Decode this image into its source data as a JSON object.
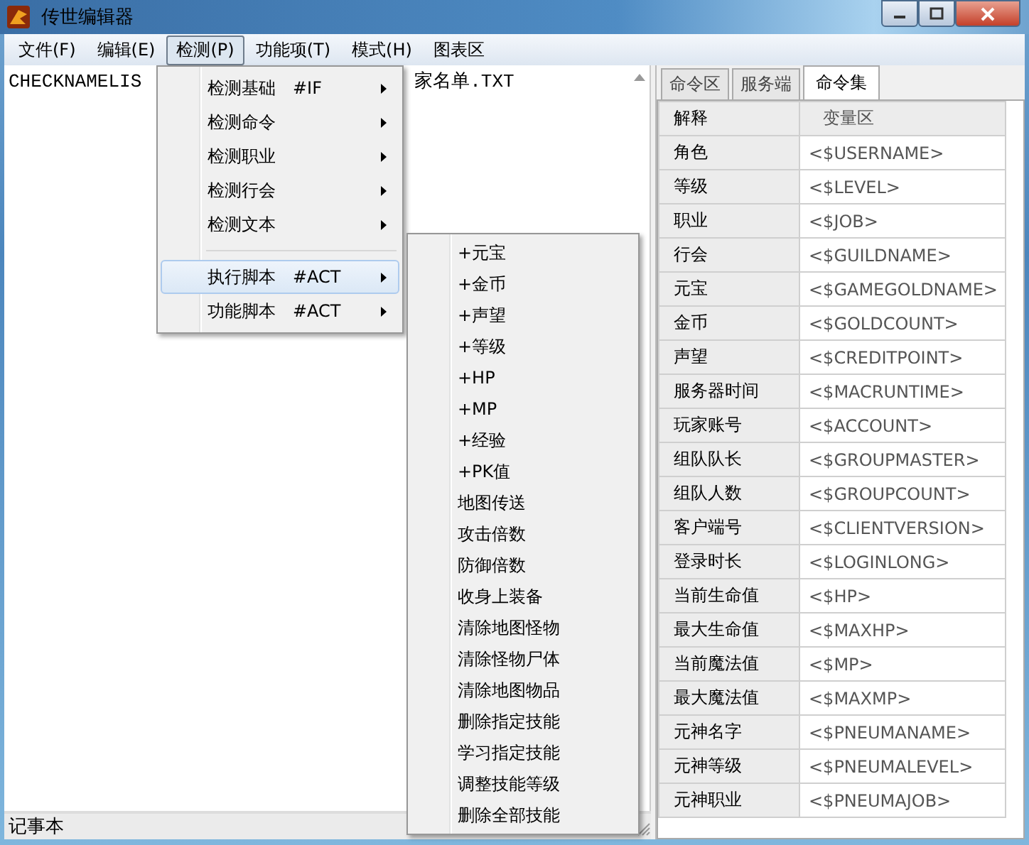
{
  "window": {
    "title": "传世编辑器"
  },
  "menu_bar": [
    {
      "label": "文件(F)",
      "selected": false
    },
    {
      "label": "编辑(E)",
      "selected": false
    },
    {
      "label": "检测(P)",
      "selected": true
    },
    {
      "label": "功能项(T)",
      "selected": false
    },
    {
      "label": "模式(H)",
      "selected": false
    },
    {
      "label": "图表区",
      "selected": false
    }
  ],
  "editor": {
    "text_fragments": [
      "CHECKNAMELIS",
      "家名单.TXT"
    ]
  },
  "status_bar": "记事本",
  "dropdown": {
    "items": [
      {
        "kind": "item",
        "label": "检测基础",
        "code": "#IF",
        "submenu": true,
        "selected": false
      },
      {
        "kind": "item",
        "label": "检测命令",
        "submenu": true,
        "selected": false
      },
      {
        "kind": "item",
        "label": "检测职业",
        "submenu": true,
        "selected": false
      },
      {
        "kind": "item",
        "label": "检测行会",
        "submenu": true,
        "selected": false
      },
      {
        "kind": "item",
        "label": "检测文本",
        "submenu": true,
        "selected": false
      },
      {
        "kind": "separator"
      },
      {
        "kind": "item",
        "label": "执行脚本",
        "code": "#ACT",
        "submenu": true,
        "selected": true
      },
      {
        "kind": "item",
        "label": "功能脚本",
        "code": "#ACT",
        "submenu": true,
        "selected": false
      }
    ]
  },
  "submenu": {
    "items": [
      "+元宝",
      "+金币",
      "+声望",
      "+等级",
      "+HP",
      "+MP",
      "+经验",
      "+PK值",
      "地图传送",
      "攻击倍数",
      "防御倍数",
      "收身上装备",
      "清除地图怪物",
      "清除怪物尸体",
      "清除地图物品",
      "删除指定技能",
      "学习指定技能",
      "调整技能等级",
      "删除全部技能"
    ]
  },
  "right_panel": {
    "tabs": [
      {
        "label": "命令区",
        "selected": false
      },
      {
        "label": "服务端",
        "selected": false
      },
      {
        "label": "命令集",
        "selected": true
      }
    ],
    "table": {
      "columns": [
        "解释",
        "变量区"
      ],
      "rows": [
        [
          "角色",
          "<$USERNAME>"
        ],
        [
          "等级",
          "<$LEVEL>"
        ],
        [
          "职业",
          "<$JOB>"
        ],
        [
          "行会",
          "<$GUILDNAME>"
        ],
        [
          "元宝",
          "<$GAMEGOLDNAME>"
        ],
        [
          "金币",
          "<$GOLDCOUNT>"
        ],
        [
          "声望",
          "<$CREDITPOINT>"
        ],
        [
          "服务器时间",
          "<$MACRUNTIME>"
        ],
        [
          "玩家账号",
          "<$ACCOUNT>"
        ],
        [
          "组队队长",
          "<$GROUPMASTER>"
        ],
        [
          "组队人数",
          "<$GROUPCOUNT>"
        ],
        [
          "客户端号",
          "<$CLIENTVERSION>"
        ],
        [
          "登录时长",
          "<$LOGINLONG>"
        ],
        [
          "当前生命值",
          "<$HP>"
        ],
        [
          "最大生命值",
          "<$MAXHP>"
        ],
        [
          "当前魔法值",
          "<$MP>"
        ],
        [
          "最大魔法值",
          "<$MAXMP>"
        ],
        [
          "元神名字",
          "<$PNEUMANAME>"
        ],
        [
          "元神等级",
          "<$PNEUMALEVEL>"
        ],
        [
          "元神职业",
          "<$PNEUMAJOB>"
        ]
      ]
    }
  }
}
